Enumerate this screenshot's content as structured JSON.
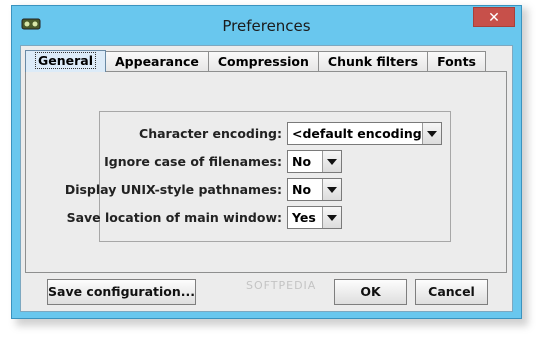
{
  "window": {
    "title": "Preferences",
    "close_glyph": "✕"
  },
  "tabs": [
    {
      "label": "General",
      "active": true
    },
    {
      "label": "Appearance",
      "active": false
    },
    {
      "label": "Compression",
      "active": false
    },
    {
      "label": "Chunk filters",
      "active": false
    },
    {
      "label": "Fonts",
      "active": false
    }
  ],
  "general": {
    "character_encoding": {
      "label": "Character encoding:",
      "value": "<default encoding>"
    },
    "ignore_case": {
      "label": "Ignore case of filenames:",
      "value": "No"
    },
    "unix_paths": {
      "label": "Display UNIX-style pathnames:",
      "value": "No"
    },
    "save_location": {
      "label": "Save location of main window:",
      "value": "Yes"
    }
  },
  "buttons": {
    "save_configuration": "Save configuration...",
    "ok": "OK",
    "cancel": "Cancel"
  },
  "watermark": "SOFTPEDIA",
  "colors": {
    "titlebar": "#69c7ee",
    "close_button": "#c7504a",
    "active_tab": "#dcebf8",
    "client_background": "#ececec"
  },
  "icons": {
    "app": "app-icon",
    "close": "close-icon",
    "dropdown": "chevron-down-icon"
  }
}
